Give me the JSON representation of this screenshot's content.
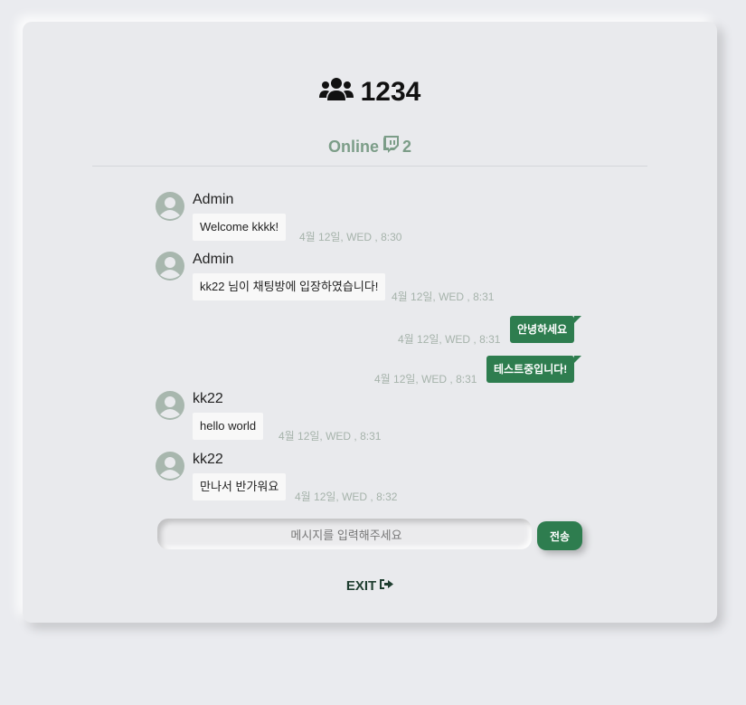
{
  "room": {
    "name": "1234",
    "icon": "users-icon"
  },
  "online": {
    "label": "Online",
    "count": "2",
    "icon": "twitch-icon"
  },
  "messages": [
    {
      "sender": "Admin",
      "text": "Welcome kkkk!",
      "time": "4월 12일, WED , 8:30",
      "direction": "in"
    },
    {
      "sender": "Admin",
      "text": "kk22 님이 채팅방에 입장하였습니다!",
      "time": "4월 12일, WED , 8:31",
      "direction": "in"
    },
    {
      "text": "안녕하세요",
      "time": "4월 12일, WED , 8:31",
      "direction": "out"
    },
    {
      "text": "테스트중입니다!",
      "time": "4월 12일, WED , 8:31",
      "direction": "out"
    },
    {
      "sender": "kk22",
      "text": "hello world",
      "time": "4월 12일, WED , 8:31",
      "direction": "in"
    },
    {
      "sender": "kk22",
      "text": "만나서 반가워요",
      "time": "4월 12일, WED , 8:32",
      "direction": "in"
    }
  ],
  "composer": {
    "placeholder": "메시지를 입력해주세요",
    "value": "",
    "send_label": "전송"
  },
  "exit": {
    "label": "EXIT",
    "icon": "sign-out-icon"
  },
  "colors": {
    "accent": "#2e7d4f",
    "online": "#7c9d88",
    "timestamp": "#a6b3ab",
    "background": "#eaebef"
  }
}
